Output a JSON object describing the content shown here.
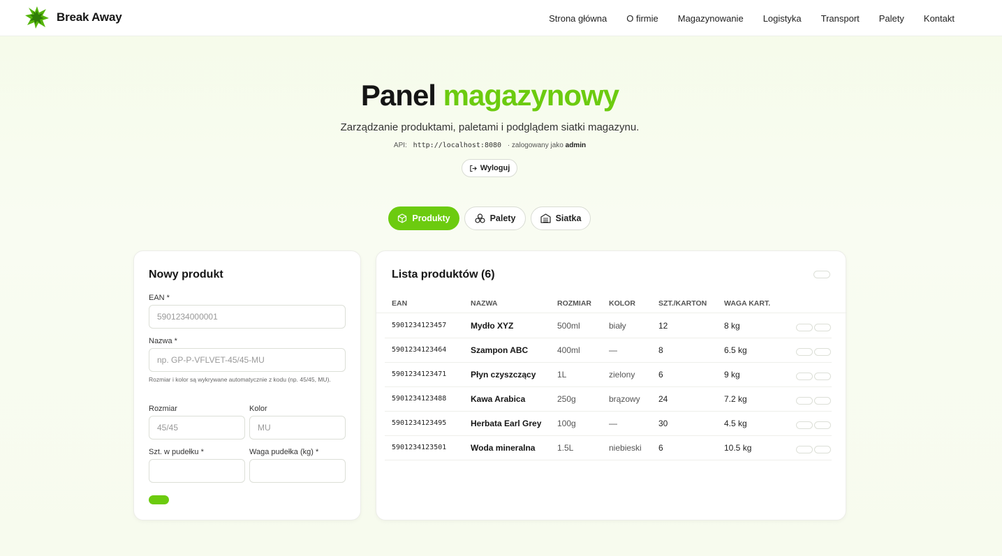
{
  "brand": {
    "name": "Break Away",
    "accent": "#6ccb0f"
  },
  "nav": [
    "Strona główna",
    "O firmie",
    "Magazynowanie",
    "Logistyka",
    "Transport",
    "Palety",
    "Kontakt"
  ],
  "hero": {
    "title_main": "Panel",
    "title_accent": "magazynowy",
    "subtitle": "Zarządzanie produktami, paletami i podglądem siatki magazynu.",
    "api_label": "API:",
    "api_url": "http://localhost:8080",
    "logged_as_text": "· zalogowany jako",
    "user": "admin",
    "logout_label": "Wyloguj"
  },
  "tabs": [
    {
      "label": "Produkty",
      "icon": "box-icon",
      "active": true
    },
    {
      "label": "Palety",
      "icon": "pallet-icon",
      "active": false
    },
    {
      "label": "Siatka",
      "icon": "warehouse-icon",
      "active": false
    }
  ],
  "form": {
    "title": "Nowy produkt",
    "ean_label": "EAN *",
    "ean_placeholder": "5901234000001",
    "name_label": "Nazwa *",
    "name_placeholder": "np. GP-P-VFLVET-45/45-MU",
    "hint": "Rozmiar i kolor są wykrywane automatycznie z kodu (np. 45/45, MU).",
    "size_label": "Rozmiar",
    "size_placeholder": "45/45",
    "color_label": "Kolor",
    "color_placeholder": "MU",
    "qty_label": "Szt. w pudełku *",
    "weight_label": "Waga pudełka (kg) *"
  },
  "list": {
    "title": "Lista produktów (6)",
    "columns": [
      "EAN",
      "NAZWA",
      "ROZMIAR",
      "KOLOR",
      "SZT./KARTON",
      "WAGA KART."
    ],
    "rows": [
      [
        "5901234123457",
        "Mydło XYZ",
        "500ml",
        "biały",
        "12",
        "8 kg"
      ],
      [
        "5901234123464",
        "Szampon ABC",
        "400ml",
        "—",
        "8",
        "6.5 kg"
      ],
      [
        "5901234123471",
        "Płyn czyszczący",
        "1L",
        "zielony",
        "6",
        "9 kg"
      ],
      [
        "5901234123488",
        "Kawa Arabica",
        "250g",
        "brązowy",
        "24",
        "7.2 kg"
      ],
      [
        "5901234123495",
        "Herbata Earl Grey",
        "100g",
        "—",
        "30",
        "4.5 kg"
      ],
      [
        "5901234123501",
        "Woda mineralna",
        "1.5L",
        "niebieski",
        "6",
        "10.5 kg"
      ]
    ]
  }
}
